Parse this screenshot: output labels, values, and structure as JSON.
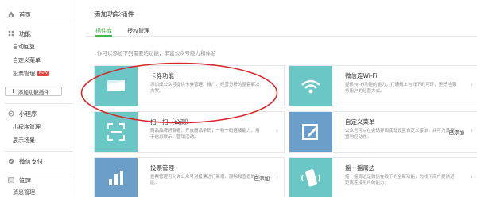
{
  "sidebar": {
    "home": "首页",
    "feature_section": "功能",
    "feature_items": [
      "自动回复",
      "自定义菜单",
      "投票管理"
    ],
    "vote_badge": "NEW",
    "add_plugin": "添加功能插件",
    "miniprogram_section": "小程序",
    "miniprogram_items": [
      "小程序管理",
      "展示场景"
    ],
    "wechat_pay": "微信支付",
    "manage_section": "管理",
    "manage_items": [
      "消息管理"
    ]
  },
  "main": {
    "title": "添加功能插件",
    "tabs": [
      "插件库",
      "授权管理"
    ],
    "active_tab": "插件库",
    "hint": "你可以添加下列需要的功能，丰富公众号能力和体验"
  },
  "plugins": [
    {
      "title": "卡券功能",
      "desc": "添加成公众号提供卡券管理、推广、经营分析的整套解决方案。",
      "added": "",
      "color": "#6ac7c5",
      "icon": "card-icon",
      "highlighted": true
    },
    {
      "title": "微信连Wi-Fi",
      "desc": "提供Wi-Fi功能的能力，打通线上与线下的可环，更好地服务用户的经营方式。",
      "added": "",
      "color": "#6ac7c5",
      "icon": "wifi-icon",
      "highlighted": false
    },
    {
      "title": "扫一扫（公测）",
      "desc": "商品品牌所有者，开放商品条码，一物一码连接能力，用于信息展示、营销活动。",
      "added": "",
      "color": "#6ac7c5",
      "icon": "scan-icon",
      "highlighted": false
    },
    {
      "title": "自定义菜单",
      "desc": "公众号可以在会话界面底部设置自定义菜单，并可为其设置响应动作。",
      "added": "已添加",
      "color": "#6b9ec8",
      "icon": "edit-icon",
      "highlighted": false
    },
    {
      "title": "投票管理",
      "desc": "投票管理可允许公众号对投票进行新增、删除和查看的功能。",
      "added": "已添加",
      "color": "#6b9ec8",
      "icon": "bar-chart-icon",
      "highlighted": false
    },
    {
      "title": "摇一摇周边",
      "desc": "摇一摇周边是微信在线下的全新功能，为线下商户提供近距离连接用户的能力。",
      "added": "",
      "color": "#6ac7c5",
      "icon": "shake-icon",
      "highlighted": false
    }
  ]
}
